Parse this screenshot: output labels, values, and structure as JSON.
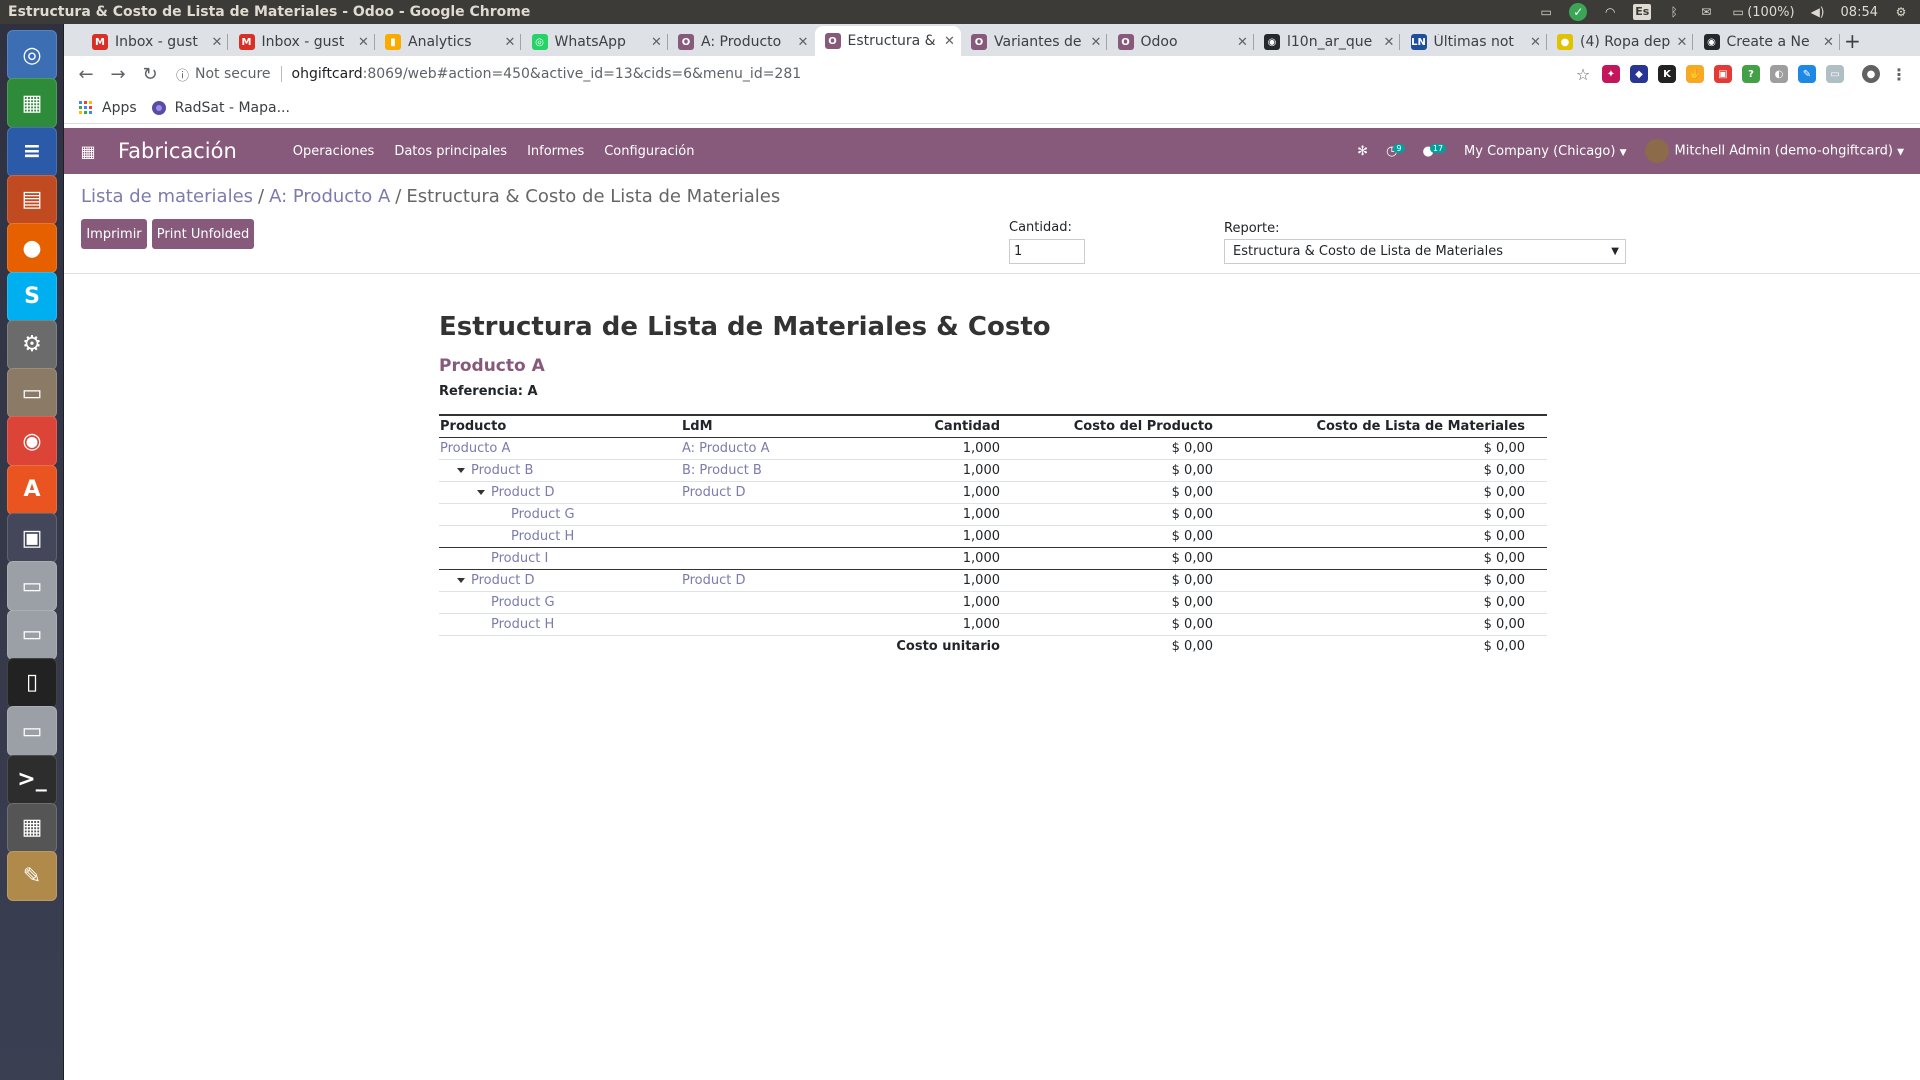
{
  "window": {
    "title": "Estructura & Costo de Lista de Materiales - Odoo - Google Chrome"
  },
  "tray": {
    "lang": "Es",
    "battery": "(100%)",
    "time": "08:54"
  },
  "launcher": [
    {
      "name": "ubuntu-icon",
      "glyph": "◎",
      "color": "#3c6eb4"
    },
    {
      "name": "spreadsheet-icon",
      "glyph": "▦",
      "color": "#2e8b3a"
    },
    {
      "name": "writer-icon",
      "glyph": "≡",
      "color": "#2a5aa8"
    },
    {
      "name": "impress-icon",
      "glyph": "▤",
      "color": "#c14a20"
    },
    {
      "name": "firefox-icon",
      "glyph": "●",
      "color": "#e66000"
    },
    {
      "name": "skype-icon",
      "glyph": "S",
      "color": "#00aff0"
    },
    {
      "name": "settings-icon",
      "glyph": "⚙",
      "color": "#6b6b6b"
    },
    {
      "name": "files-icon",
      "glyph": "▭",
      "color": "#8a7a66"
    },
    {
      "name": "chrome-icon",
      "glyph": "◉",
      "color": "#db4437"
    },
    {
      "name": "software-center-icon",
      "glyph": "A",
      "color": "#e95420"
    },
    {
      "name": "workspaces-icon",
      "glyph": "▣",
      "color": "#44475a"
    },
    {
      "name": "drive-icon",
      "glyph": "▭",
      "color": "#9aa0a6"
    },
    {
      "name": "drive-icon-2",
      "glyph": "▭",
      "color": "#9aa0a6"
    },
    {
      "name": "phone-icon",
      "glyph": "▯",
      "color": "#222222"
    },
    {
      "name": "drive-icon-3",
      "glyph": "▭",
      "color": "#9aa0a6"
    },
    {
      "name": "terminal-icon",
      "glyph": ">_",
      "color": "#2d2d2d"
    },
    {
      "name": "calculator-icon",
      "glyph": "▦",
      "color": "#555555"
    },
    {
      "name": "text-editor-icon",
      "glyph": "✎",
      "color": "#b08a4a"
    }
  ],
  "tabs": [
    {
      "title": "Inbox - gust",
      "fav": "M",
      "color": "#d93025",
      "active": false
    },
    {
      "title": "Inbox - gust",
      "fav": "M",
      "color": "#d93025",
      "active": false
    },
    {
      "title": "Analytics",
      "fav": "▮",
      "color": "#f9ab00",
      "active": false
    },
    {
      "title": "WhatsApp",
      "fav": "◎",
      "color": "#25d366",
      "active": false
    },
    {
      "title": "A: Producto",
      "fav": "O",
      "color": "#875a7b",
      "active": false
    },
    {
      "title": "Estructura &",
      "fav": "O",
      "color": "#875a7b",
      "active": true
    },
    {
      "title": "Variantes de",
      "fav": "O",
      "color": "#875a7b",
      "active": false
    },
    {
      "title": "Odoo",
      "fav": "O",
      "color": "#875a7b",
      "active": false
    },
    {
      "title": "l10n_ar_que",
      "fav": "◉",
      "color": "#24292e",
      "active": false
    },
    {
      "title": "Últimas not",
      "fav": "LN",
      "color": "#1f4e9c",
      "active": false
    },
    {
      "title": "(4) Ropa dep",
      "fav": "●",
      "color": "#e0c200",
      "active": false
    },
    {
      "title": "Create a Ne",
      "fav": "◉",
      "color": "#24292e",
      "active": false
    }
  ],
  "omnibox": {
    "security": "Not secure",
    "host": "ohgiftcard",
    "path": ":8069/web#action=450&active_id=13&cids=6&menu_id=281"
  },
  "bookmarks": [
    {
      "label": "Apps"
    },
    {
      "label": "RadSat - Mapa..."
    }
  ],
  "odoo": {
    "app": "Fabricación",
    "menu": [
      "Operaciones",
      "Datos principales",
      "Informes",
      "Configuración"
    ],
    "activity_count": "9",
    "message_count": "17",
    "company": "My Company (Chicago)",
    "user": "Mitchell Admin (demo-ohgiftcard)"
  },
  "breadcrumb": [
    "Lista de materiales",
    "A: Producto A",
    "Estructura & Costo de Lista de Materiales"
  ],
  "buttons": {
    "print": "Imprimir",
    "print_unfolded": "Print Unfolded"
  },
  "controls": {
    "qty_label": "Cantidad:",
    "qty_value": "1",
    "report_label": "Reporte:",
    "report_value": "Estructura & Costo de Lista de Materiales"
  },
  "report": {
    "title": "Estructura de Lista de Materiales & Costo",
    "product": "Producto A",
    "reference": "Referencia: A",
    "columns": [
      "Producto",
      "LdM",
      "Cantidad",
      "Costo del Producto",
      "Costo de Lista de Materiales"
    ],
    "rows": [
      {
        "product": "Producto A",
        "bom": "A: Producto A",
        "qty": "1,000",
        "cost": "$ 0,00",
        "bom_cost": "$ 0,00",
        "level": 0,
        "caret": false,
        "sep": false
      },
      {
        "product": "Product B",
        "bom": "B: Product B",
        "qty": "1,000",
        "cost": "$ 0,00",
        "bom_cost": "$ 0,00",
        "level": 1,
        "caret": true,
        "sep": false
      },
      {
        "product": "Product D",
        "bom": "Product D",
        "qty": "1,000",
        "cost": "$ 0,00",
        "bom_cost": "$ 0,00",
        "level": 2,
        "caret": true,
        "sep": false
      },
      {
        "product": "Product G",
        "bom": "",
        "qty": "1,000",
        "cost": "$ 0,00",
        "bom_cost": "$ 0,00",
        "level": 3,
        "caret": false,
        "sep": false
      },
      {
        "product": "Product H",
        "bom": "",
        "qty": "1,000",
        "cost": "$ 0,00",
        "bom_cost": "$ 0,00",
        "level": 3,
        "caret": false,
        "sep": true
      },
      {
        "product": "Product I",
        "bom": "",
        "qty": "1,000",
        "cost": "$ 0,00",
        "bom_cost": "$ 0,00",
        "level": 2,
        "caret": false,
        "sep": true
      },
      {
        "product": "Product D",
        "bom": "Product D",
        "qty": "1,000",
        "cost": "$ 0,00",
        "bom_cost": "$ 0,00",
        "level": 1,
        "caret": true,
        "sep": false
      },
      {
        "product": "Product G",
        "bom": "",
        "qty": "1,000",
        "cost": "$ 0,00",
        "bom_cost": "$ 0,00",
        "level": 2,
        "caret": false,
        "sep": false
      },
      {
        "product": "Product H",
        "bom": "",
        "qty": "1,000",
        "cost": "$ 0,00",
        "bom_cost": "$ 0,00",
        "level": 2,
        "caret": false,
        "sep": false
      }
    ],
    "footer": {
      "label": "Costo unitario",
      "cost": "$ 0,00",
      "bom_cost": "$ 0,00"
    }
  }
}
